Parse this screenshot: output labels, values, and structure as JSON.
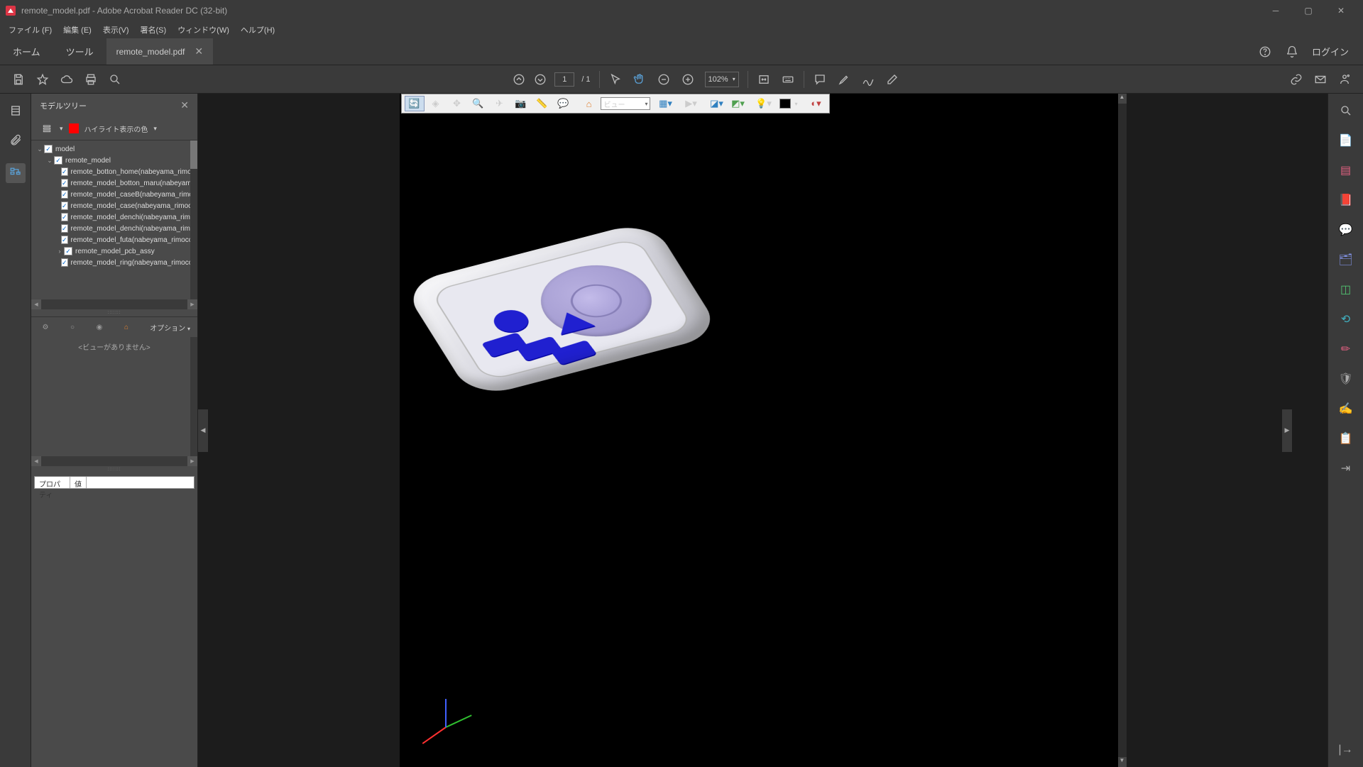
{
  "window": {
    "title": "remote_model.pdf - Adobe Acrobat Reader DC (32-bit)"
  },
  "menu": {
    "file": "ファイル (F)",
    "edit": "編集 (E)",
    "view": "表示(V)",
    "sign": "署名(S)",
    "window": "ウィンドウ(W)",
    "help": "ヘルプ(H)"
  },
  "tabs": {
    "home": "ホーム",
    "tools": "ツール",
    "doc": "remote_model.pdf",
    "login": "ログイン"
  },
  "toolbar": {
    "page_current": "1",
    "page_total": "/ 1",
    "zoom": "102%"
  },
  "panel": {
    "title": "モデルツリー",
    "highlight": "ハイライト表示の色",
    "options": "オプション",
    "no_views": "<ビューがありません>",
    "prop_col1": "プロパティ",
    "prop_col2": "値"
  },
  "tree": {
    "root": "model",
    "n1": "remote_model",
    "i1": "remote_botton_home(nabeyama_rimoco",
    "i2": "remote_model_botton_maru(nabeyama_",
    "i3": "remote_model_caseB(nabeyama_rimoco",
    "i4": "remote_model_case(nabeyama_rimocon",
    "i5": "remote_model_denchi(nabeyama_rimoc",
    "i6": "remote_model_denchi(nabeyama_rimoc",
    "i7": "remote_model_futa(nabeyama_rimocon_",
    "i8": "remote_model_pcb_assy",
    "i9": "remote_model_ring(nabeyama_rimocon_"
  },
  "doc3d": {
    "view_label": "ビュー"
  }
}
